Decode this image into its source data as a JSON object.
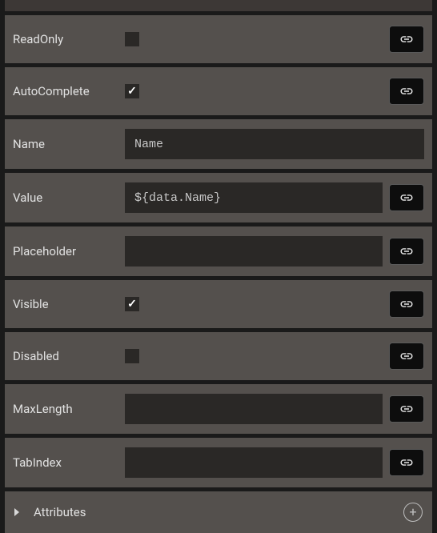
{
  "properties": {
    "readOnly": {
      "label": "ReadOnly",
      "checked": false
    },
    "autoComplete": {
      "label": "AutoComplete",
      "checked": true
    },
    "name": {
      "label": "Name",
      "value": "Name"
    },
    "value": {
      "label": "Value",
      "value": "${data.Name}"
    },
    "placeholder": {
      "label": "Placeholder",
      "value": ""
    },
    "visible": {
      "label": "Visible",
      "checked": true
    },
    "disabled": {
      "label": "Disabled",
      "checked": false
    },
    "maxLength": {
      "label": "MaxLength",
      "value": ""
    },
    "tabIndex": {
      "label": "TabIndex",
      "value": ""
    }
  },
  "section": {
    "attributes": "Attributes"
  }
}
